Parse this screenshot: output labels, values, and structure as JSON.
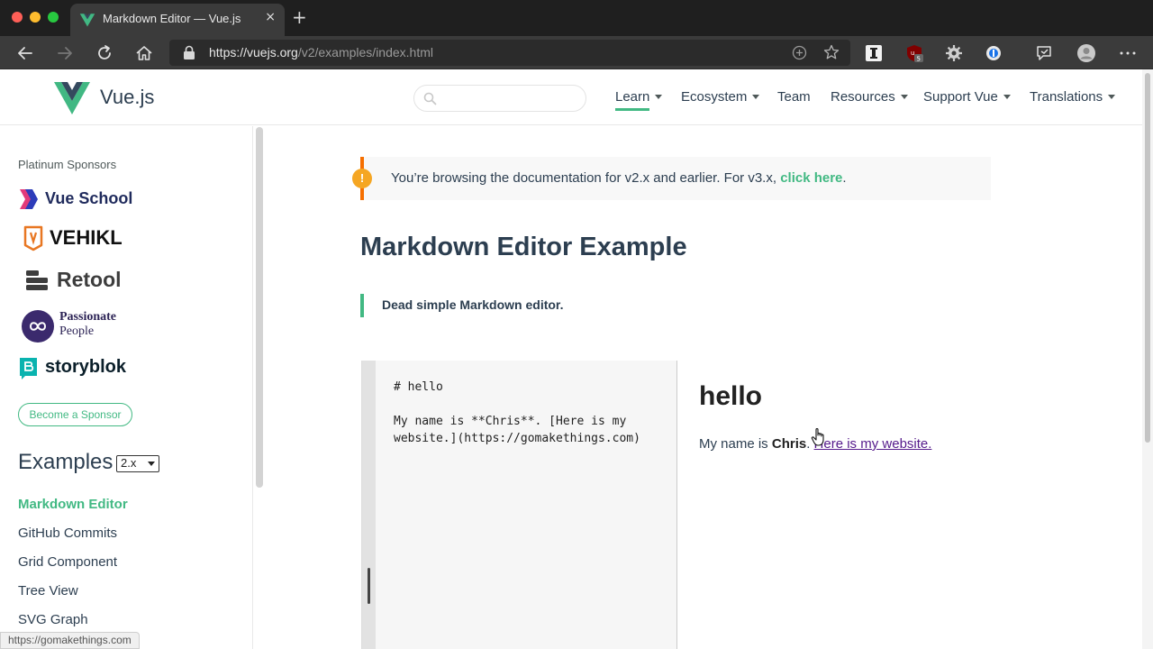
{
  "browser": {
    "tab_title": "Markdown Editor — Vue.js",
    "new_tab_symbol": "+",
    "close_symbol": "×",
    "url_host": "https://vuejs.org",
    "url_path": "/v2/examples/index.html",
    "extension_badge": "5",
    "status_url": "https://gomakethings.com"
  },
  "site": {
    "logo_text": "Vue.js",
    "search_value": "",
    "nav": {
      "learn": "Learn",
      "ecosystem": "Ecosystem",
      "team": "Team",
      "resources": "Resources",
      "support": "Support Vue",
      "translations": "Translations"
    },
    "accent_color": "#42b983"
  },
  "sidebar": {
    "sponsors_label": "Platinum Sponsors",
    "sponsors": [
      "Vue School",
      "VEHIKL",
      "Retool",
      "Passionate",
      "People",
      "storyblok"
    ],
    "become_sponsor": "Become a Sponsor",
    "examples_heading": "Examples",
    "version_selected": "2.x",
    "links": [
      "Markdown Editor",
      "GitHub Commits",
      "Grid Component",
      "Tree View",
      "SVG Graph"
    ]
  },
  "content": {
    "notice_badge": "!",
    "notice_text": "You’re browsing the documentation for v2.x and earlier. For v3.x, ",
    "notice_link": "click here",
    "notice_end": ".",
    "title": "Markdown Editor Example",
    "quote": "Dead simple Markdown editor.",
    "editor_source": "# hello\n\nMy name is **Chris**. [Here is my website.](https://gomakethings.com)",
    "preview": {
      "heading": "hello",
      "text_before": "My name is ",
      "bold": "Chris",
      "text_after": ". ",
      "link": "Here is my website."
    }
  }
}
